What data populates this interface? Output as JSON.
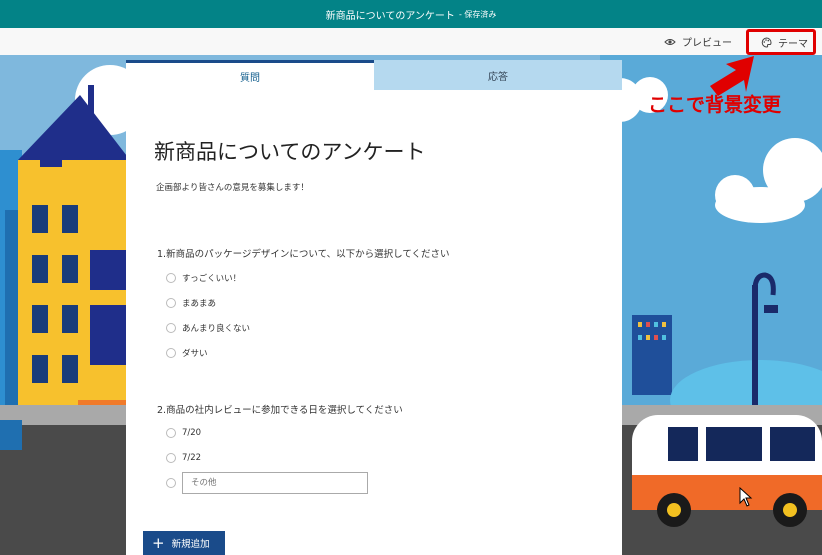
{
  "topbar": {
    "title": "新商品についてのアンケート",
    "saved": "- 保存済み"
  },
  "commandbar": {
    "preview": "プレビュー",
    "theme": "テーマ"
  },
  "tabs": {
    "questions": "質問",
    "responses": "応答"
  },
  "form": {
    "title": "新商品についてのアンケート",
    "description": "企画部より皆さんの意見を募集します！",
    "q1": {
      "text": "1.新商品のパッケージデザインについて、以下から選択してください",
      "options": [
        "すっごくいい！",
        "まあまあ",
        "あんまり良くない",
        "ダサい"
      ]
    },
    "q2": {
      "text": "2.商品の社内レビューに参加できる日を選択してください",
      "options": [
        "7/20",
        "7/22"
      ],
      "other_placeholder": "その他"
    }
  },
  "add_button": "新規追加",
  "annotation": "ここで背景変更",
  "colors": {
    "topbar": "#038387",
    "accent": "#1a4b8a",
    "annotation": "#e00000",
    "tab_inactive": "#b5d9ef"
  }
}
